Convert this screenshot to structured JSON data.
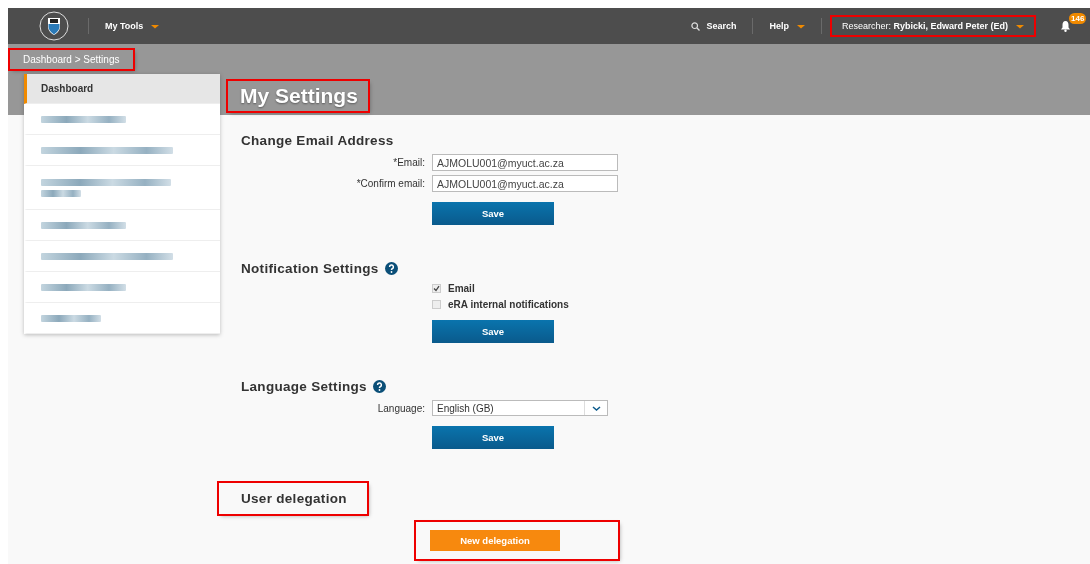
{
  "header": {
    "menu": {
      "label": "My Tools"
    },
    "search": "Search",
    "help": "Help",
    "user": {
      "role": "Researcher:",
      "name": "Rybicki, Edward Peter (Ed)",
      "annotated": true
    },
    "notification_count": "146"
  },
  "breadcrumb": {
    "text": "Dashboard > Settings",
    "annotated": true
  },
  "sidebar": {
    "items": [
      {
        "kind": "link",
        "label": "Dashboard",
        "selected": true
      },
      {
        "kind": "redacted",
        "selected": false
      },
      {
        "kind": "redacted",
        "selected": false
      },
      {
        "kind": "redacted_two_line",
        "selected": false
      },
      {
        "kind": "redacted",
        "selected": false
      },
      {
        "kind": "redacted",
        "selected": false
      },
      {
        "kind": "redacted",
        "selected": false
      },
      {
        "kind": "redacted",
        "selected": false
      }
    ]
  },
  "page_title": {
    "text": "My Settings",
    "annotated": true
  },
  "sections": [
    {
      "kind": "fields",
      "title": "Change Email Address",
      "fields": [
        {
          "label": "*Email:",
          "value": "AJMOLU001@myuct.ac.za"
        },
        {
          "label": "*Confirm email:",
          "value": "AJMOLU001@myuct.ac.za"
        }
      ],
      "button": {
        "label": "Save",
        "kind": "primary"
      }
    },
    {
      "kind": "checks",
      "title": "Notification Settings",
      "help": true,
      "options": [
        {
          "label": "Email",
          "checked": true
        },
        {
          "label": "eRA internal notifications",
          "checked": false
        }
      ],
      "button": {
        "label": "Save",
        "kind": "primary"
      }
    },
    {
      "kind": "select",
      "title": "Language Settings",
      "help": true,
      "label": "Language:",
      "value": "English (GB)",
      "button": {
        "label": "Save",
        "kind": "primary"
      }
    },
    {
      "kind": "action",
      "title": "User delegation",
      "annotated": true,
      "button": {
        "label": "New delegation",
        "kind": "accent",
        "annotated": true
      }
    }
  ]
}
